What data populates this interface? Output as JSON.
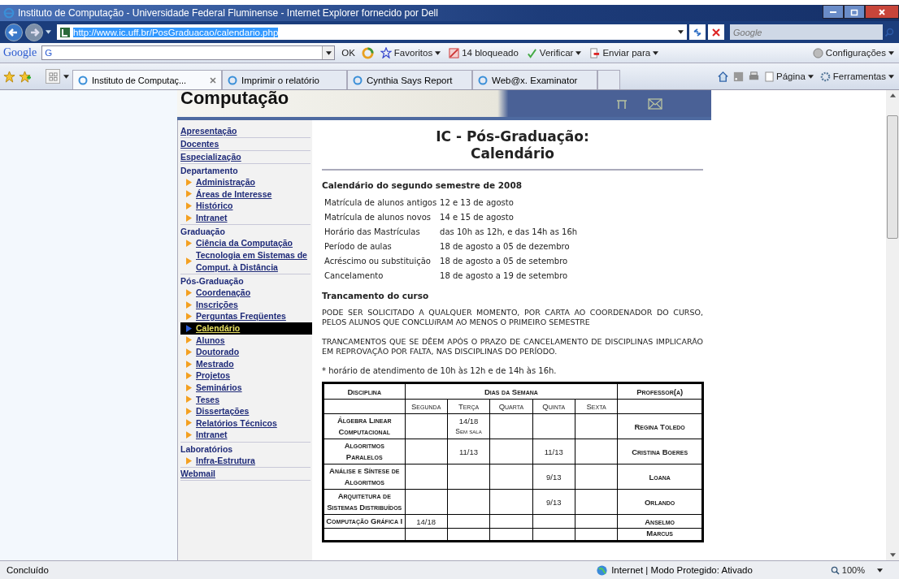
{
  "window": {
    "title": "Instituto de Computação - Universidade Federal Fluminense - Internet Explorer fornecido por Dell"
  },
  "address_bar": {
    "value": "http://www.ic.uff.br/PosGraduacao/calendario.php"
  },
  "search": {
    "placeholder": "Google"
  },
  "google_toolbar": {
    "logo": "Google",
    "engine": "G",
    "ok": "OK",
    "favorites": "Favoritos",
    "blocked": "14 bloqueado",
    "check": "Verificar",
    "send": "Enviar para",
    "settings": "Configurações"
  },
  "tabs": [
    {
      "label": "Instituto de Computaç...",
      "selected": true
    },
    {
      "label": "Imprimir o relatório",
      "selected": false
    },
    {
      "label": "Cynthia Says Report",
      "selected": false
    },
    {
      "label": "Web@x. Examinator",
      "selected": false
    }
  ],
  "command_bar": {
    "page": "Página",
    "tools": "Ferramentas"
  },
  "banner": {
    "title": "Computação"
  },
  "sidebar": [
    {
      "label": "Apresentação",
      "kind": "link"
    },
    {
      "label": "Docentes",
      "kind": "link"
    },
    {
      "label": "Especialização",
      "kind": "link"
    },
    {
      "label": "Departamento",
      "kind": "heading",
      "children": [
        {
          "label": "Administração",
          "selected": false
        },
        {
          "label": "Áreas de Interesse",
          "selected": false
        },
        {
          "label": "Histórico",
          "selected": false
        },
        {
          "label": "Intranet",
          "selected": false
        }
      ]
    },
    {
      "label": "Graduação",
      "kind": "heading",
      "children": [
        {
          "label": "Ciência da Computação",
          "selected": false
        },
        {
          "label": "Tecnologia em Sistemas de Comput. à Distância",
          "selected": false
        }
      ]
    },
    {
      "label": "Pós-Graduação",
      "kind": "heading",
      "children": [
        {
          "label": "Coordenação",
          "selected": false
        },
        {
          "label": "Inscrições",
          "selected": false
        },
        {
          "label": "Perguntas Freqüentes",
          "selected": false
        },
        {
          "label": "Calendário",
          "selected": true
        },
        {
          "label": "Alunos",
          "selected": false
        },
        {
          "label": "Doutorado",
          "selected": false
        },
        {
          "label": "Mestrado",
          "selected": false
        },
        {
          "label": "Projetos",
          "selected": false
        },
        {
          "label": "Seminários",
          "selected": false
        },
        {
          "label": "Teses",
          "selected": false
        },
        {
          "label": "Dissertações",
          "selected": false
        },
        {
          "label": "Relatórios Técnicos",
          "selected": false
        },
        {
          "label": "Intranet",
          "selected": false
        }
      ]
    },
    {
      "label": "Laboratórios",
      "kind": "heading",
      "children": [
        {
          "label": "Infra-Estrutura",
          "selected": false
        }
      ]
    },
    {
      "label": "Webmail",
      "kind": "link"
    }
  ],
  "content": {
    "title": [
      "IC - Pós-Graduação:",
      "Calendário"
    ],
    "semester_heading": "Calendário do segundo semestre de 2008",
    "schedule": [
      {
        "label": "Matrícula de alunos antigos",
        "value": "12 e 13 de agosto"
      },
      {
        "label": "Matrícula de alunos novos",
        "value": "14 e 15 de agosto"
      },
      {
        "label": "Horário das Mastrículas",
        "value": "das 10h as 12h, e das 14h as 16h"
      },
      {
        "label": "Período de aulas",
        "value": "18 de agosto a 05 de dezembro"
      },
      {
        "label": "Acréscimo ou substituição",
        "value": "18 de agosto a 05 de setembro"
      },
      {
        "label": "Cancelamento",
        "value": "18 de agosto a 19 de setembro"
      }
    ],
    "lock_heading": "Trancamento do curso",
    "paragraphs": [
      "PODE SER SOLICITADO A QUALQUER MOMENTO, POR CARTA AO COORDENADOR DO CURSO, PELOS ALUNOS QUE CONCLUíRAM AO MENOS O PRIMEIRO SEMESTRE",
      "TRANCAMENTOS QUE SE DÊEM APÓS O PRAZO DE CANCELAMENTO DE DISCIPLINAS IMPLICARÃO EM REPROVAÇÃO POR FALTA, NAS DISCIPLINAS DO PERÍODO."
    ],
    "footnote": "* horário de atendimento de 10h às 12h e de 14h às 16h."
  },
  "table": {
    "header_rows": [
      [
        {
          "text": "Disciplina"
        },
        {
          "text": "Dias da Semana",
          "colspan": 5
        },
        {
          "text": "Professor(a)"
        }
      ],
      [
        null,
        {
          "text": "Segunda"
        },
        {
          "text": "Terça"
        },
        {
          "text": "Quarta"
        },
        {
          "text": "Quinta"
        },
        {
          "text": "Sexta"
        },
        null
      ]
    ],
    "rows": [
      {
        "discipline": "Álgebra Linear Computacional",
        "cells": [
          null,
          {
            "text": "14/18",
            "note": "Sem sala"
          },
          null,
          null,
          null
        ],
        "professor": "Regina Toledo"
      },
      {
        "discipline": "Algoritmos Paralelos",
        "cells": [
          null,
          {
            "text": "11/13"
          },
          null,
          {
            "text": "11/13"
          },
          null
        ],
        "professor": "Cristina Boeres"
      },
      {
        "discipline": "Análise e Síntese de Algoritmos",
        "cells": [
          null,
          null,
          null,
          {
            "text": "9/13"
          },
          null
        ],
        "professor": "Loana"
      },
      {
        "discipline": "Arquitetura de Sistemas Distribuídos",
        "cells": [
          null,
          null,
          null,
          {
            "text": "9/13"
          },
          null
        ],
        "professor": "Orlando"
      },
      {
        "discipline": "Computação Gráfica I",
        "cells": [
          {
            "text": "14/18"
          },
          null,
          null,
          null,
          null
        ],
        "professor": "Anselmo"
      },
      {
        "cells": [
          null,
          null,
          null,
          null,
          null
        ],
        "professor": "Marcus"
      }
    ]
  },
  "status_bar": {
    "text": "Concluído",
    "zone": "Internet | Modo Protegido: Ativado",
    "zoom": "100%"
  }
}
